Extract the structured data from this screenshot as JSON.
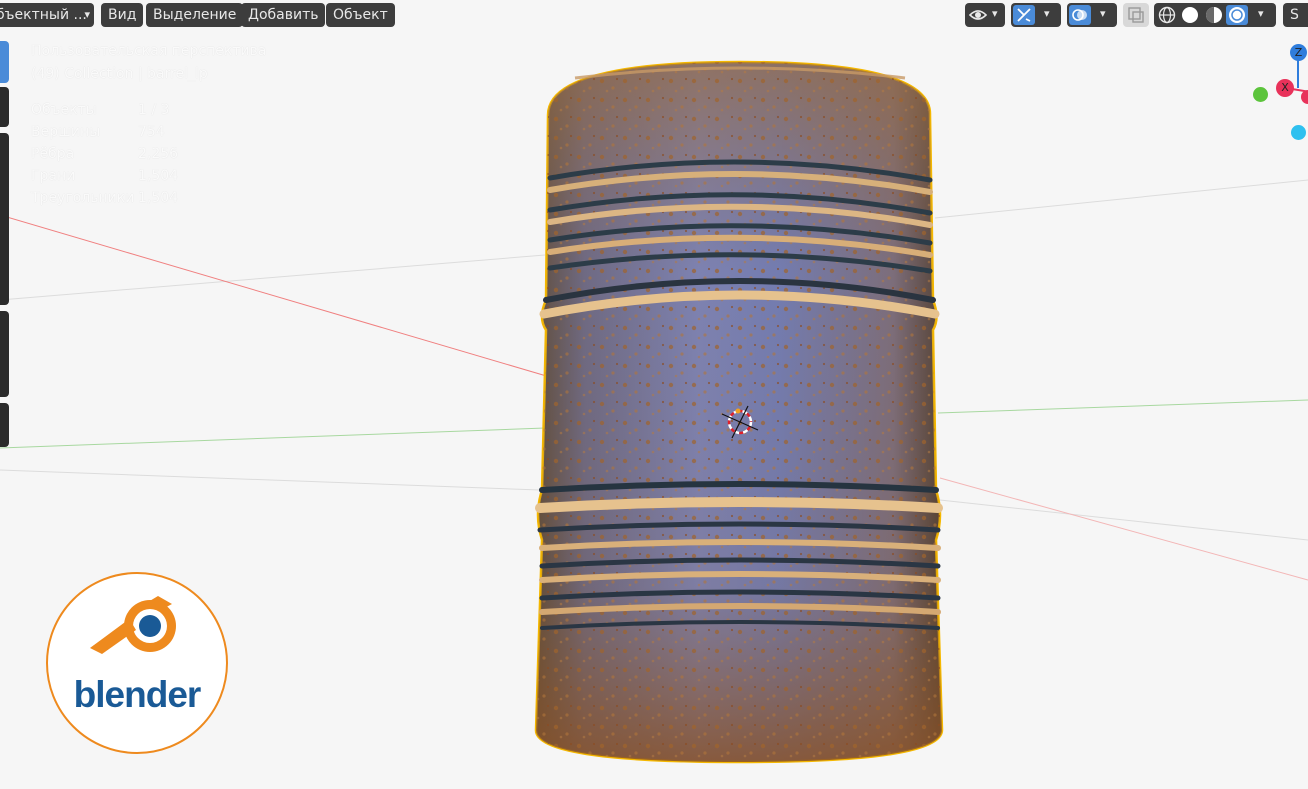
{
  "header": {
    "mode_label": "бъектный ...",
    "menus": [
      "Вид",
      "Выделение",
      "Добавить",
      "Объект"
    ],
    "right_cut_label": "S"
  },
  "overlay": {
    "view_name": "Пользовательская перспектива",
    "collection": "(49) Collection | barrel_lp",
    "stats": [
      {
        "label": "Объекты",
        "value": "1 / 3"
      },
      {
        "label": "Вершины",
        "value": "754"
      },
      {
        "label": "Рёбра",
        "value": "2,256"
      },
      {
        "label": "Грани",
        "value": "1,504"
      },
      {
        "label": "Треугольники",
        "value": "1,504"
      }
    ]
  },
  "gizmo": {
    "z_label": "Z",
    "x_label": "X"
  },
  "logo": {
    "wordmark": "blender"
  },
  "colors": {
    "accent": "#4a8bd8",
    "selection_outline": "#f5b800",
    "x_axis": "#e8325a",
    "y_axis": "#5cc43c",
    "z_axis": "#2f7ddc",
    "logo_orange": "#ee8a1e",
    "logo_blue": "#1a5a96"
  }
}
